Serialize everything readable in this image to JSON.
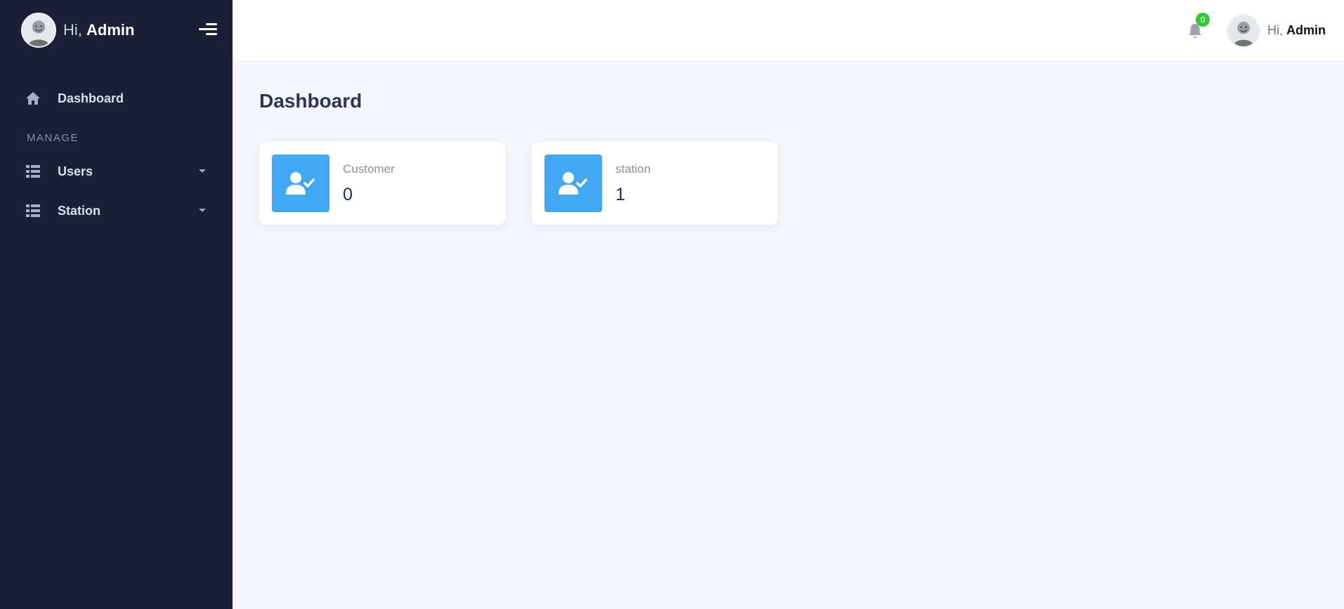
{
  "sidebar": {
    "greeting": "Hi,",
    "user_name": "Admin",
    "items": [
      {
        "label": "Dashboard",
        "icon": "home-icon"
      }
    ],
    "section_label": "MANAGE",
    "manage_items": [
      {
        "label": "Users",
        "icon": "table-list-icon"
      },
      {
        "label": "Station",
        "icon": "table-list-icon"
      }
    ]
  },
  "topbar": {
    "notification_count": "0",
    "greeting": "Hi,",
    "user_name": "Admin"
  },
  "page": {
    "title": "Dashboard"
  },
  "cards": [
    {
      "label": "Customer",
      "value": "0",
      "icon": "user-check-icon"
    },
    {
      "label": "station",
      "value": "1",
      "icon": "user-check-icon"
    }
  ],
  "colors": {
    "sidebar_bg": "#1b2037",
    "accent": "#42a8f5",
    "badge": "#34c933",
    "page_bg": "#f4f6fb"
  }
}
